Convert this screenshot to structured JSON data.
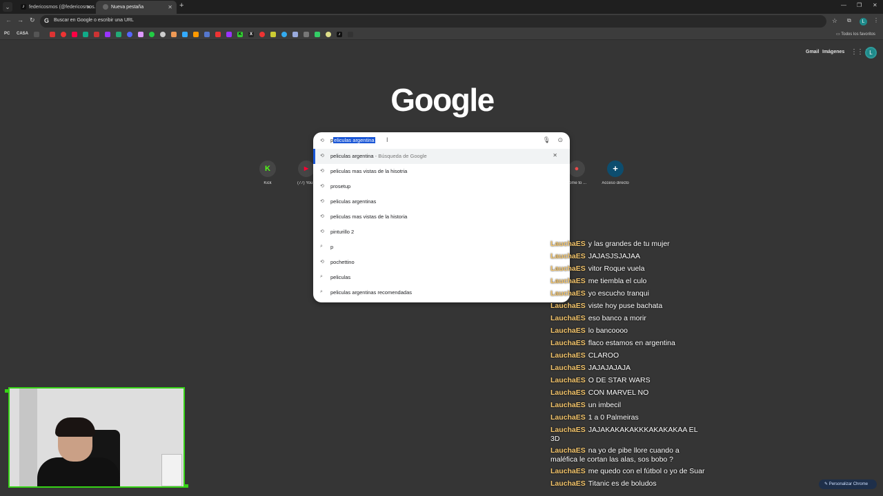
{
  "tabs": [
    {
      "title": "federicosmos (@federicosmos...",
      "icon": "tiktok-icon"
    },
    {
      "title": "Nueva pestaña",
      "icon": "chrome-icon"
    }
  ],
  "omnibox": {
    "placeholder": "Buscar en Google o escribir una URL"
  },
  "bookmarks": {
    "pc_label": "PC",
    "casa_label": "CASA",
    "all_favorites": "Todos los favoritos"
  },
  "header": {
    "gmail": "Gmail",
    "images": "Imágenes",
    "profile_initial": "L"
  },
  "logo": "Google",
  "search": {
    "query_first_char": "p",
    "query_selected": "eliculas argentina",
    "suggestions": [
      {
        "text": "peliculas argentina",
        "sub": " - Búsqueda de Google",
        "icon": "history-icon",
        "active": true
      },
      {
        "text": "peliculas mas vistas de la hisotria",
        "sub": "",
        "icon": "history-icon"
      },
      {
        "text": "prosetup",
        "sub": "",
        "icon": "history-icon"
      },
      {
        "text": "peliculas argentinas",
        "sub": "",
        "icon": "history-icon"
      },
      {
        "text": "peliculas mas vistas de la historia",
        "sub": "",
        "icon": "history-icon"
      },
      {
        "text": "pinturillo 2",
        "sub": "",
        "icon": "history-icon"
      },
      {
        "text": "p",
        "sub": "",
        "icon": "search-icon"
      },
      {
        "text": "pochettino",
        "sub": "",
        "icon": "history-icon"
      },
      {
        "text": "peliculas",
        "sub": "",
        "icon": "search-icon"
      },
      {
        "text": "peliculas argentinas recomendadas",
        "sub": "",
        "icon": "search-icon"
      }
    ]
  },
  "shortcuts": [
    {
      "label": "Kick",
      "glyph": "K",
      "color": "#53fc18"
    },
    {
      "label": "(77) YouT",
      "glyph": "▶",
      "color": "#ff0033"
    },
    {
      "label": "come to ...",
      "glyph": "●",
      "color": "#e84b4b"
    },
    {
      "label": "Acceso directo",
      "glyph": "+",
      "color": "#ffffff"
    }
  ],
  "chat": [
    {
      "user": "LauchaES",
      "msg": "y las grandes de tu mujer"
    },
    {
      "user": "LauchaES",
      "msg": "JAJASJSJAJAA"
    },
    {
      "user": "LauchaES",
      "msg": "vitor Roque vuela"
    },
    {
      "user": "LauchaES",
      "msg": "me tiembla el culo"
    },
    {
      "user": "LauchaES",
      "msg": "yo escucho tranqui"
    },
    {
      "user": "LauchaES",
      "msg": "viste hoy puse bachata"
    },
    {
      "user": "LauchaES",
      "msg": "eso banco a morir"
    },
    {
      "user": "LauchaES",
      "msg": "lo bancoooo"
    },
    {
      "user": "LauchaES",
      "msg": "flaco estamos en argentina"
    },
    {
      "user": "LauchaES",
      "msg": "CLAROO"
    },
    {
      "user": "LauchaES",
      "msg": "JAJAJAJAJA"
    },
    {
      "user": "LauchaES",
      "msg": "O DE STAR WARS"
    },
    {
      "user": "LauchaES",
      "msg": "CON MARVEL NO"
    },
    {
      "user": "LauchaES",
      "msg": "un imbecil"
    },
    {
      "user": "LauchaES",
      "msg": "1 a 0 Palmeiras"
    },
    {
      "user": "LauchaES",
      "msg": "JAJAKAKAKAKKKAKAKAKAA EL 3D"
    },
    {
      "user": "LauchaES",
      "msg": "na yo de pibe llore cuando a maléfica le cortan las alas, sos bobo ?"
    },
    {
      "user": "LauchaES",
      "msg": "me quedo con el fútbol o yo de Suar"
    },
    {
      "user": "LauchaES",
      "msg": "Titanic es de boludos"
    }
  ],
  "personalize": "Personalizar Chrome"
}
